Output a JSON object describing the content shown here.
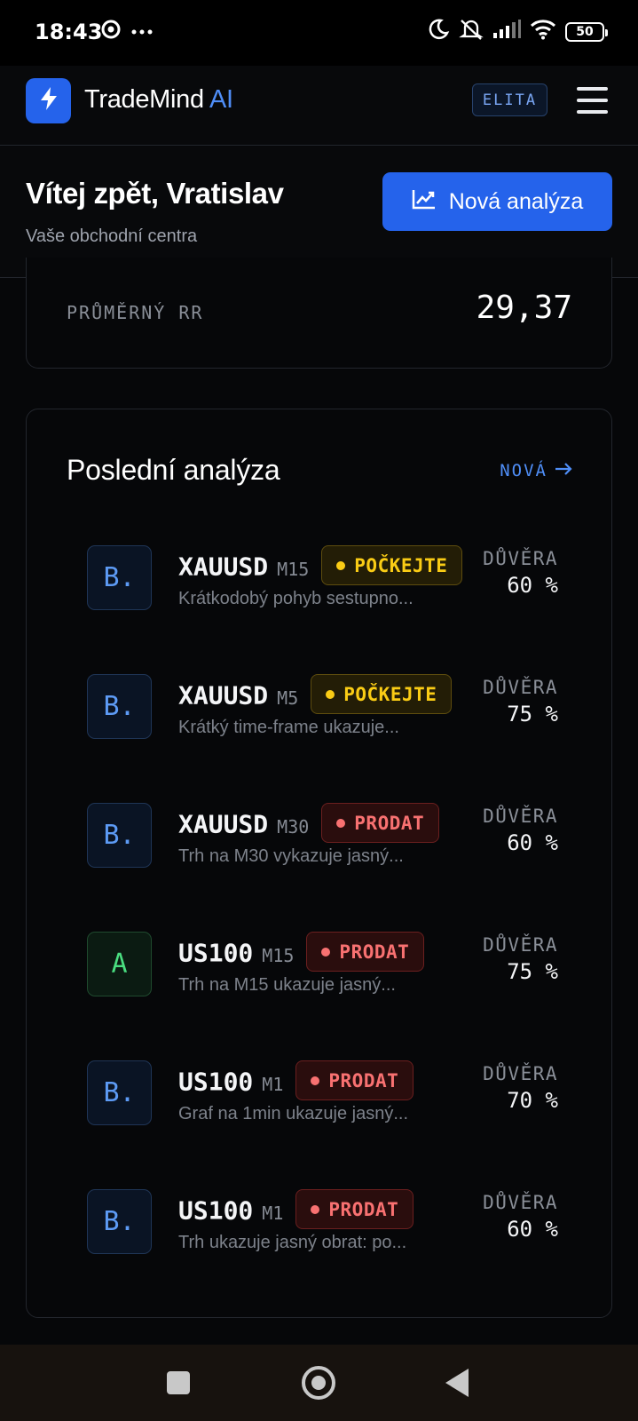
{
  "status_bar": {
    "time": "18:43",
    "battery": "50",
    "icons": [
      "chrome-icon",
      "more-dots-icon",
      "moon-icon",
      "mute-icon",
      "signal-icon",
      "wifi-icon",
      "battery-icon"
    ]
  },
  "header": {
    "brand_main": "TradeMind",
    "brand_accent": "AI",
    "tier": "ELITA",
    "logo_icon": "lightning-icon",
    "menu_icon": "hamburger-icon"
  },
  "welcome": {
    "title": "Vítej zpět, Vratislav",
    "subtitle": "Vaše obchodní centra",
    "new_analysis_button": "Nová analýza",
    "button_icon": "chart-line-icon"
  },
  "stats": {
    "avg_rr_label": "PRŮMĚRNÝ RR",
    "avg_rr_value": "29,37"
  },
  "recent": {
    "title": "Poslední analýza",
    "link": "NOVÁ",
    "confidence_label": "DŮVĚRA",
    "items": [
      {
        "grade": "B.",
        "symbol": "XAUUSD",
        "timeframe": "M15",
        "signal": "POČKEJTE",
        "signal_type": "wait",
        "description": "Krátkodobý pohyb sestupno...",
        "confidence": "60 %"
      },
      {
        "grade": "B.",
        "symbol": "XAUUSD",
        "timeframe": "M5",
        "signal": "POČKEJTE",
        "signal_type": "wait",
        "description": "Krátký time-frame ukazuje...",
        "confidence": "75 %"
      },
      {
        "grade": "B.",
        "symbol": "XAUUSD",
        "timeframe": "M30",
        "signal": "PRODAT",
        "signal_type": "sell",
        "description": "Trh na M30 vykazuje jasný...",
        "confidence": "60 %"
      },
      {
        "grade": "A",
        "symbol": "US100",
        "timeframe": "M15",
        "signal": "PRODAT",
        "signal_type": "sell",
        "description": "Trh na M15 ukazuje jasný...",
        "confidence": "75 %"
      },
      {
        "grade": "B.",
        "symbol": "US100",
        "timeframe": "M1",
        "signal": "PRODAT",
        "signal_type": "sell",
        "description": "Graf na 1min ukazuje jasný...",
        "confidence": "70 %"
      },
      {
        "grade": "B.",
        "symbol": "US100",
        "timeframe": "M1",
        "signal": "PRODAT",
        "signal_type": "sell",
        "description": "Trh ukazuje jasný obrat: po...",
        "confidence": "60 %"
      }
    ]
  },
  "colors": {
    "accent": "#2563eb",
    "wait": "#facc15",
    "sell": "#f87171",
    "grade_a": "#4ade80",
    "grade_b": "#5d9bf5"
  }
}
